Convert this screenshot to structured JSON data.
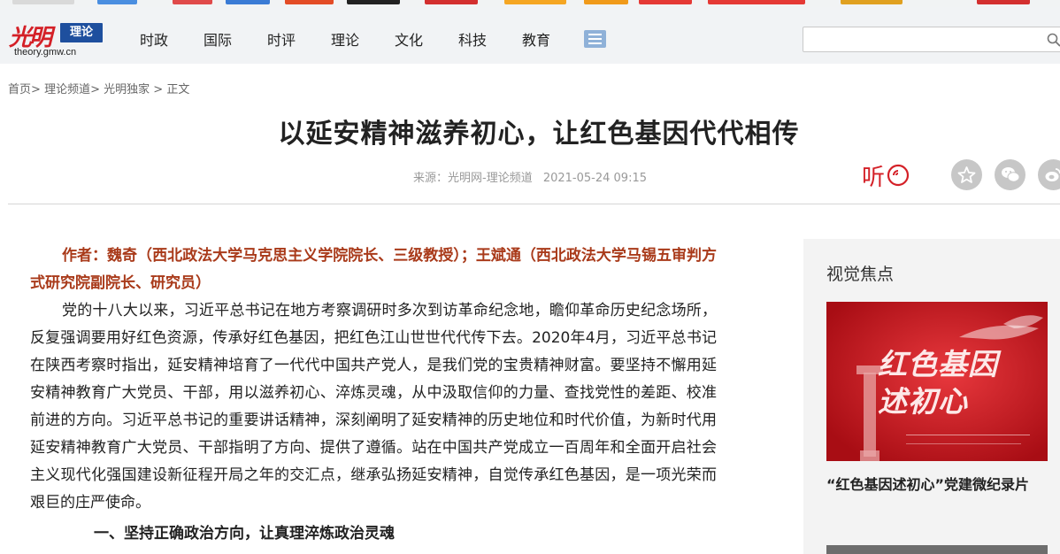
{
  "header": {
    "logo_mark": "光明",
    "logo_badge": "理论",
    "logo_domain": "theory.gmw.cn",
    "nav": [
      {
        "label": "时政"
      },
      {
        "label": "国际"
      },
      {
        "label": "时评"
      },
      {
        "label": "理论"
      },
      {
        "label": "文化"
      },
      {
        "label": "科技"
      },
      {
        "label": "教育"
      }
    ],
    "menu_icon": "list-icon",
    "search": {
      "value": "",
      "placeholder": "",
      "icon": "search-icon"
    }
  },
  "breadcrumb": [
    {
      "label": "首页"
    },
    {
      "label": "理论频道"
    },
    {
      "label": "光明独家"
    },
    {
      "label": "正文"
    }
  ],
  "breadcrumb_sep": ">",
  "article": {
    "title": "以延安精神滋养初心，让红色基因代代相传",
    "source": "来源：光明网-理论频道",
    "date": "2021-05-24 09:15",
    "listen_label": "听",
    "share_icons": [
      "favorite-icon",
      "wechat-icon",
      "weibo-icon"
    ],
    "author": "作者：魏奇（西北政法大学马克思主义学院院长、三级教授）；王斌通（西北政法大学马锡五审判方式研究院副院长、研究员）",
    "paragraphs": [
      "党的十八大以来，习近平总书记在地方考察调研时多次到访革命纪念地，瞻仰革命历史纪念场所，反复强调要用好红色资源，传承好红色基因，把红色江山世世代代传下去。2020年4月，习近平总书记在陕西考察时指出，延安精神培育了一代代中国共产党人，是我们党的宝贵精神财富。要坚持不懈用延安精神教育广大党员、干部，用以滋养初心、淬炼灵魂，从中汲取信仰的力量、查找党性的差距、校准前进的方向。习近平总书记的重要讲话精神，深刻阐明了延安精神的历史地位和时代价值，为新时代用延安精神教育广大党员、干部指明了方向、提供了遵循。站在中国共产党成立一百周年和全面开启社会主义现代化强国建设新征程开局之年的交汇点，继承弘扬延安精神，自觉传承红色基因，是一项光荣而艰巨的庄严使命。"
    ],
    "subhead": "一、坚持正确政治方向，让真理淬炼政治灵魂"
  },
  "sidebar": {
    "title": "视觉焦点",
    "image_text": "红色基因述初心",
    "caption": "“红色基因述初心”党建微纪录片"
  },
  "colors": {
    "brand_red": "#d42027",
    "logo_blue": "#1e4f9e",
    "author_color": "#a93a1a",
    "topbar_bg": "#f1f3f5"
  }
}
